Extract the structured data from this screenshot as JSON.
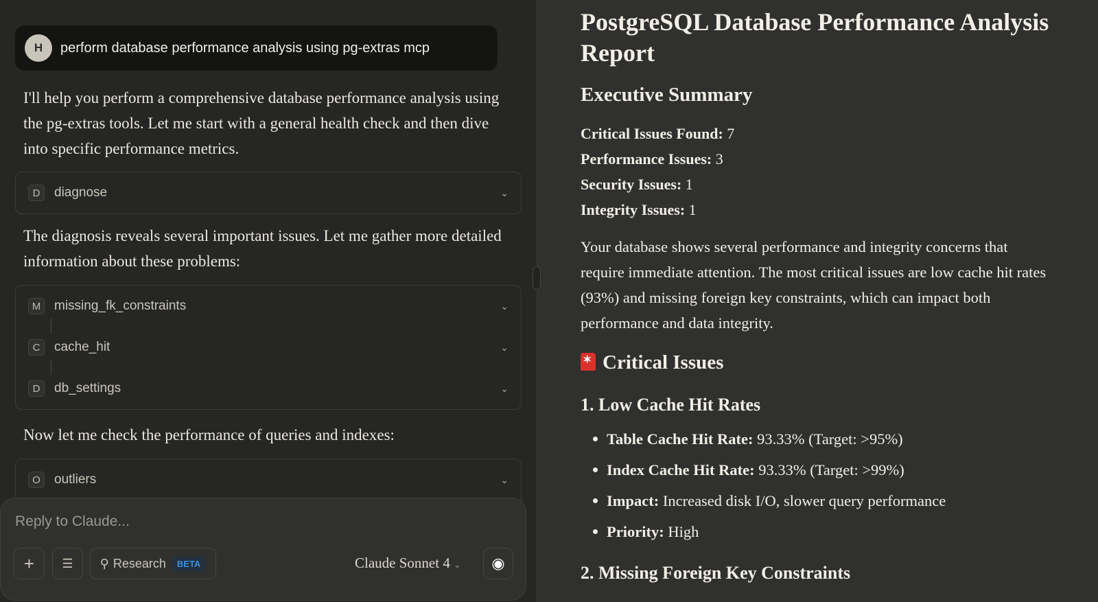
{
  "chat": {
    "user": {
      "avatar": "H",
      "message": "perform database performance analysis using pg-extras mcp"
    },
    "p1": "I'll help you perform a comprehensive database performance analysis using the pg-extras tools. Let me start with a general health check and then dive into specific performance metrics.",
    "tool1": {
      "badge": "D",
      "name": "diagnose"
    },
    "p2": "The diagnosis reveals several important issues. Let me gather more detailed information about these problems:",
    "tools2": [
      {
        "badge": "M",
        "name": "missing_fk_constraints"
      },
      {
        "badge": "C",
        "name": "cache_hit"
      },
      {
        "badge": "D",
        "name": "db_settings"
      }
    ],
    "p3": "Now let me check the performance of queries and indexes:",
    "tool3": {
      "badge": "O",
      "name": "outliers"
    }
  },
  "composer": {
    "placeholder": "Reply to Claude...",
    "research": "Research",
    "beta": "BETA",
    "model": "Claude Sonnet 4"
  },
  "report": {
    "title": "PostgreSQL Database Performance Analysis Report",
    "summary_heading": "Executive Summary",
    "stats": [
      {
        "k": "Critical Issues Found:",
        "v": "7"
      },
      {
        "k": "Performance Issues:",
        "v": "3"
      },
      {
        "k": "Security Issues:",
        "v": "1"
      },
      {
        "k": "Integrity Issues:",
        "v": "1"
      }
    ],
    "summary": "Your database shows several performance and integrity concerns that require immediate attention. The most critical issues are low cache hit rates (93%) and missing foreign key constraints, which can impact both performance and data integrity.",
    "critical_heading": "Critical Issues",
    "issue1": "1. Low Cache Hit Rates",
    "bullets": [
      {
        "k": "Table Cache Hit Rate:",
        "v": "93.33% (Target: >95%)"
      },
      {
        "k": "Index Cache Hit Rate:",
        "v": "93.33% (Target: >99%)"
      },
      {
        "k": "Impact:",
        "v": "Increased disk I/O, slower query performance"
      },
      {
        "k": "Priority:",
        "v": "High"
      }
    ],
    "issue2": "2. Missing Foreign Key Constraints"
  }
}
